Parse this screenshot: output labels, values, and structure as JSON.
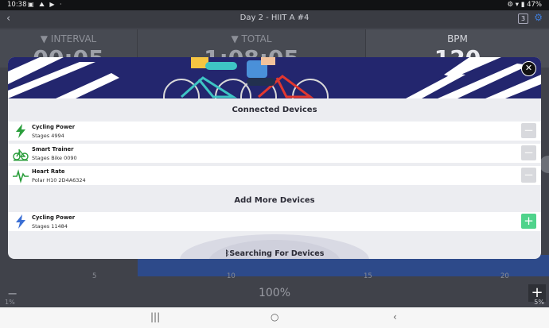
{
  "status_bar": {
    "time": "10:38",
    "icons_left": "▣ ⛰ ▶ ·",
    "icons_right": "⚙ ▾ ▮ 47%"
  },
  "workout": {
    "title": "Day 2 - HIIT A #4",
    "back_glyph": "‹",
    "count_badge": "3",
    "tiles": [
      {
        "label": "▼ INTERVAL",
        "value": "00:05"
      },
      {
        "label": "▼ TOTAL",
        "value": "1:08:05"
      },
      {
        "label": "BPM",
        "value": "120"
      }
    ],
    "chart_ticks": [
      "5",
      "10",
      "15",
      "20"
    ],
    "intensity": "100%",
    "left_percent": "1%",
    "right_percent": "5%"
  },
  "modal": {
    "close_glyph": "✕",
    "connected_title": "Connected Devices",
    "connected_devices": [
      {
        "name": "Cycling Power",
        "id": "Stages 4994",
        "icon": "power-bolt",
        "color": "#2b9e3c"
      },
      {
        "name": "Smart Trainer",
        "id": "Stages Bike 0090",
        "icon": "bike",
        "color": "#2b9e3c"
      },
      {
        "name": "Heart Rate",
        "id": "Polar H10 2D4A6324",
        "icon": "heartbeat",
        "color": "#2b9e3c"
      }
    ],
    "add_title": "Add More Devices",
    "available_devices": [
      {
        "name": "Cycling Power",
        "id": "Stages 11484",
        "icon": "power-bolt",
        "color": "#3b6fd4"
      }
    ],
    "minus_glyph": "−",
    "plus_glyph": "+",
    "searching_text": "Searching For Devices",
    "bluetooth_glyph": "ᛒ"
  },
  "navbar": {
    "recents": "|||",
    "home": "○",
    "back": "‹"
  },
  "colors": {
    "accent_green": "#4fd38b",
    "hero_navy": "#23266e",
    "bpm_blue": "#2d4a8a"
  }
}
